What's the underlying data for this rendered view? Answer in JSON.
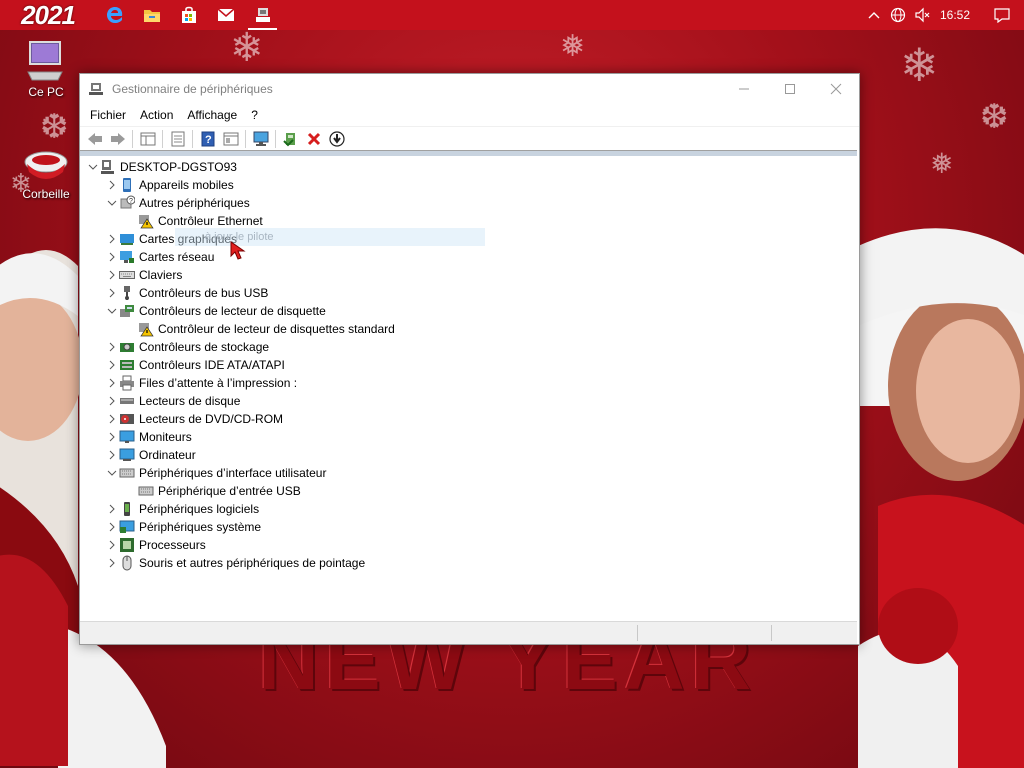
{
  "taskbar": {
    "logo_text": "2021",
    "apps": [
      "edge-icon",
      "file-explorer-icon",
      "store-icon",
      "mail-icon",
      "device-manager-icon"
    ],
    "clock": "16:52"
  },
  "desktop": {
    "icons": [
      {
        "label": "Ce PC",
        "icon": "computer-icon"
      },
      {
        "label": "Corbeille",
        "icon": "recycle-bin-icon"
      }
    ],
    "background_text": "NEW YEAR"
  },
  "window": {
    "title": "Gestionnaire de périphériques",
    "menu": [
      "Fichier",
      "Action",
      "Affichage",
      "?"
    ],
    "toolbar": [
      "back-icon",
      "forward-icon",
      "properties-grid-icon",
      "properties-icon",
      "help-icon",
      "view-icon",
      "monitor-scan-icon",
      "update-driver-icon",
      "uninstall-icon",
      "download-icon"
    ],
    "tree": {
      "root": "DESKTOP-DGSTO93",
      "categories": [
        {
          "label": "Appareils mobiles",
          "expanded": false,
          "icon": "mobile-icon"
        },
        {
          "label": "Autres périphériques",
          "expanded": true,
          "icon": "unknown-device-icon",
          "children": [
            "Contrôleur Ethernet"
          ]
        },
        {
          "label": "Cartes graphiques",
          "expanded": false,
          "icon": "display-adapter-icon"
        },
        {
          "label": "Cartes réseau",
          "expanded": false,
          "icon": "network-adapter-icon"
        },
        {
          "label": "Claviers",
          "expanded": false,
          "icon": "keyboard-icon"
        },
        {
          "label": "Contrôleurs de bus USB",
          "expanded": false,
          "icon": "usb-icon"
        },
        {
          "label": "Contrôleurs de lecteur de disquette",
          "expanded": true,
          "icon": "floppy-controller-icon",
          "children": [
            "Contrôleur de lecteur de disquettes standard"
          ]
        },
        {
          "label": "Contrôleurs de stockage",
          "expanded": false,
          "icon": "storage-controller-icon"
        },
        {
          "label": "Contrôleurs IDE ATA/ATAPI",
          "expanded": false,
          "icon": "ide-controller-icon"
        },
        {
          "label": "Files d’attente à l’impression :",
          "expanded": false,
          "icon": "printer-icon"
        },
        {
          "label": "Lecteurs de disque",
          "expanded": false,
          "icon": "disk-drive-icon"
        },
        {
          "label": "Lecteurs de DVD/CD-ROM",
          "expanded": false,
          "icon": "dvd-icon"
        },
        {
          "label": "Moniteurs",
          "expanded": false,
          "icon": "monitor-icon"
        },
        {
          "label": "Ordinateur",
          "expanded": false,
          "icon": "computer-icon"
        },
        {
          "label": "Périphériques d’interface utilisateur",
          "expanded": true,
          "icon": "hid-icon",
          "children": [
            "Périphérique d’entrée USB"
          ]
        },
        {
          "label": "Périphériques logiciels",
          "expanded": false,
          "icon": "software-device-icon"
        },
        {
          "label": "Périphériques système",
          "expanded": false,
          "icon": "system-device-icon"
        },
        {
          "label": "Processeurs",
          "expanded": false,
          "icon": "processor-icon"
        },
        {
          "label": "Souris et autres périphériques de pointage",
          "expanded": false,
          "icon": "mouse-icon"
        }
      ]
    },
    "ghost_tooltip": "à jour le pilote"
  }
}
